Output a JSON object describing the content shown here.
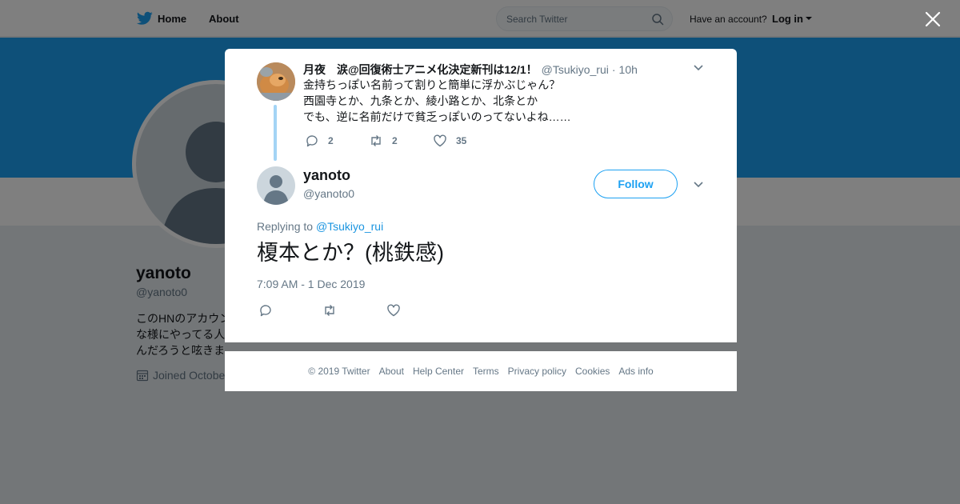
{
  "nav": {
    "home": "Home",
    "about": "About",
    "search_placeholder": "Search Twitter",
    "have_account": "Have an account?",
    "login": "Log in"
  },
  "profile": {
    "name": "yanoto",
    "handle": "@yanoto0",
    "bio": "このHNのアカウン\nな様にやってる人\nんだろうと呟きま",
    "joined": "Joined Octobe"
  },
  "context_tweet": {
    "name": "月夜　涙@回復術士アニメ化決定新刊は12/1！",
    "handle": "@Tsukiyo_rui",
    "separator": "·",
    "time": "10h",
    "text": "金持ちっぽい名前って割りと簡単に浮かぶじゃん？\n西園寺とか、九条とか、綾小路とか、北条とか\nでも、逆に名前だけで貧乏っぽいのってないよね……",
    "replies": "2",
    "retweets": "2",
    "likes": "35"
  },
  "main_tweet": {
    "name": "yanoto",
    "handle": "@yanoto0",
    "follow_label": "Follow",
    "replying_prefix": "Replying to",
    "replying_to": "@Tsukiyo_rui",
    "text": "榎本とか？(桃鉄感)",
    "timestamp": "7:09 AM - 1 Dec 2019"
  },
  "footer": {
    "copyright": "© 2019 Twitter",
    "about": "About",
    "help": "Help Center",
    "terms": "Terms",
    "privacy": "Privacy policy",
    "cookies": "Cookies",
    "ads": "Ads info"
  },
  "colors": {
    "accent": "#1da1f2",
    "link": "#1b95e0",
    "muted": "#657786",
    "thread_line": "#a3d4f5"
  },
  "icons": [
    "twitter-bird-icon",
    "search-icon",
    "caret-down-icon",
    "close-icon",
    "reply-icon",
    "retweet-icon",
    "heart-icon",
    "calendar-icon",
    "chevron-down-icon"
  ]
}
